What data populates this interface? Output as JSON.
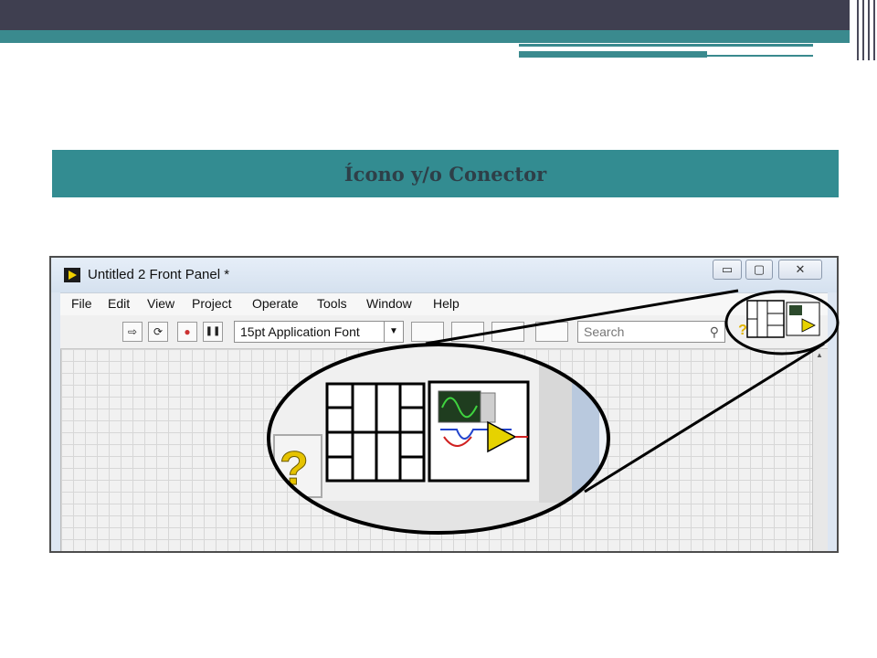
{
  "slide": {
    "title": "Ícono y/o Conector"
  },
  "window": {
    "title": "Untitled 2 Front Panel *",
    "minimize": "▭",
    "maximize": "▢",
    "close": "✕"
  },
  "menu": {
    "items": [
      "File",
      "Edit",
      "View",
      "Project",
      "Operate",
      "Tools",
      "Window",
      "Help"
    ]
  },
  "toolbar": {
    "run": "⇨",
    "run_continuously": "⟳",
    "abort": "●",
    "pause": "❚❚",
    "font": "15pt Application Font",
    "search_placeholder": "Search",
    "help": "?"
  },
  "colors": {
    "slide_dark": "#3f3f50",
    "slide_teal": "#338c91",
    "title_text": "#2e3f48",
    "window_frame": "#dde6f2"
  }
}
